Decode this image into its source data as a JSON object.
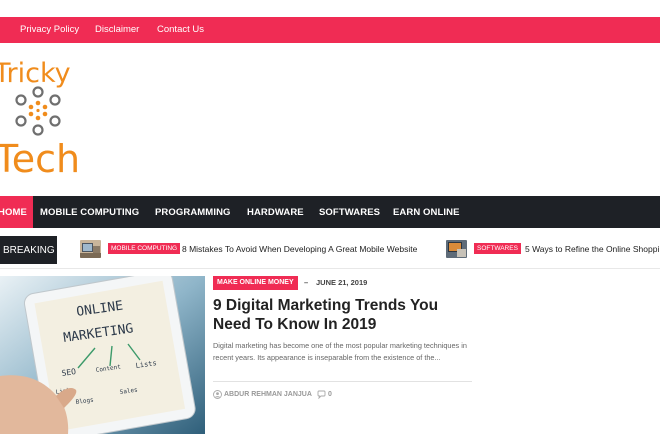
{
  "top_nav": {
    "items": [
      "Privacy Policy",
      "Disclaimer",
      "Contact Us"
    ]
  },
  "logo": {
    "line1": "Tricky",
    "line2": "Tech"
  },
  "main_nav": {
    "items": [
      "HOME",
      "MOBILE COMPUTING",
      "PROGRAMMING",
      "HARDWARE",
      "SOFTWARES",
      "EARN ONLINE"
    ]
  },
  "breaking": {
    "label": "BREAKING",
    "items": [
      {
        "category": "MOBILE COMPUTING",
        "title": "8 Mistakes To Avoid When Developing A Great Mobile Website"
      },
      {
        "category": "SOFTWARES",
        "title": "5 Ways to Refine the Online Shoppi"
      }
    ]
  },
  "featured": {
    "category": "MAKE ONLINE MONEY",
    "date_sep": "–",
    "date": "JUNE 21, 2019",
    "title": "9 Digital Marketing Trends You Need To Know In 2019",
    "excerpt": "Digital marketing has become one of the most popular marketing techniques in recent years. Its appearance is inseparable from the existence of the...",
    "author": "ABDUR REHMAN JANJUA",
    "comments": "0",
    "image_text": {
      "main": "ONLINE MARKETING",
      "words": [
        "SEO",
        "Content",
        "Lists",
        "Links",
        "Blogs",
        "Sales",
        "$"
      ]
    }
  },
  "colors": {
    "accent": "#f02c54",
    "dark_nav": "#1e2126",
    "logo": "#f08c1c"
  },
  "icons": {
    "author": "user-icon",
    "comments": "comment-icon"
  }
}
